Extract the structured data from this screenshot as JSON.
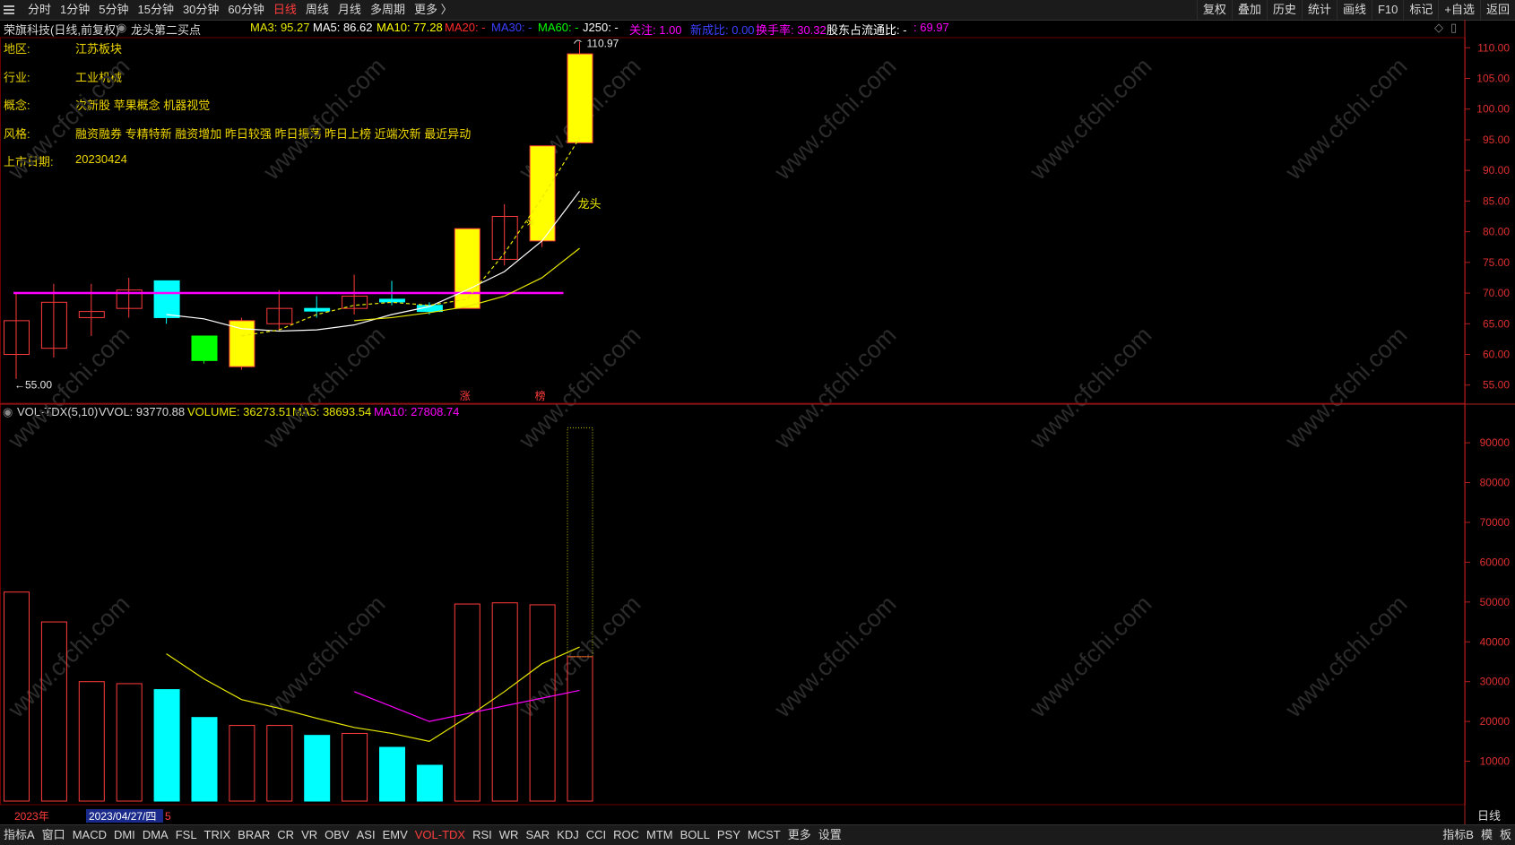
{
  "topbar": {
    "tabs": [
      "分时",
      "1分钟",
      "5分钟",
      "15分钟",
      "30分钟",
      "60分钟",
      "日线",
      "周线",
      "月线",
      "多周期",
      "更多 〉"
    ],
    "active_tab": "日线",
    "tools": [
      "复权",
      "叠加",
      "历史",
      "统计",
      "画线",
      "F10",
      "标记",
      "+自选",
      "返回"
    ]
  },
  "title": {
    "stock": "荣旗科技(日线,前复权)",
    "strategy": "龙头第二买点",
    "ma3": "MA3: 95.27",
    "ma5": "MA5: 86.62",
    "ma10": "MA10: 77.28",
    "ma20": "MA20: -",
    "ma30": "MA30: -",
    "ma60": "MA60: -",
    "j250": "J250: -",
    "focus": "关注: 1.00",
    "newrate": "新成比: 0.00",
    "turnover": "换手率: 30.32",
    "holders": "股东占流通比: -",
    "holders2": ": 69.97"
  },
  "info": [
    {
      "label": "地区:",
      "value": "江苏板块"
    },
    {
      "label": "行业:",
      "value": "工业机械"
    },
    {
      "label": "概念:",
      "value": "次新股 苹果概念 机器视觉"
    },
    {
      "label": "风格:",
      "value": "融资融券 专精特新 融资增加 昨日较强 昨日振荡 昨日上榜 近端次新 最近异动"
    },
    {
      "label": "上市日期:",
      "value": "20230424"
    }
  ],
  "annotations": {
    "high": "110.97",
    "low": "55.00",
    "leader": "龙头",
    "zhang": "涨",
    "bang": "榜",
    "year": "2023年",
    "date_cursor": "2023/04/27/四",
    "date_suffix": "5",
    "period_label": "日线"
  },
  "volume_header": {
    "name": "VOL-TDX(5,10)",
    "vvol": "VVOL: 93770.88",
    "volume": "VOLUME: 36273.51",
    "ma5": "MA5: 38693.54",
    "ma10": "MA10: 27808.74"
  },
  "bottombar": {
    "items": [
      "指标A",
      "窗口",
      "MACD",
      "DMI",
      "DMA",
      "FSL",
      "TRIX",
      "BRAR",
      "CR",
      "VR",
      "OBV",
      "ASI",
      "EMV",
      "VOL-TDX",
      "RSI",
      "WR",
      "SAR",
      "KDJ",
      "CCI",
      "ROC",
      "MTM",
      "BOLL",
      "PSY",
      "MCST",
      "更多",
      "设置"
    ],
    "active": "VOL-TDX",
    "right_items": [
      "指标B",
      "模",
      "板"
    ]
  },
  "watermark": "www.cfchi.com",
  "colors": {
    "up": "#ff3c3c",
    "up_strong": "#ffff00",
    "down": "#00ffff",
    "down_green": "#00ff00",
    "ma_white": "#ffffff",
    "ma_yellow": "#e8e800",
    "ma_magenta": "#ff00ff",
    "grid": "#6a0000"
  },
  "chart_data": {
    "type": "candlestick",
    "price_axis": {
      "ticks": [
        55,
        60,
        65,
        70,
        75,
        80,
        85,
        90,
        95,
        100,
        105,
        110
      ],
      "ylim": [
        53.5,
        111.5
      ]
    },
    "resistance_line": 70.0,
    "candles": [
      {
        "o": 60.0,
        "h": 70.0,
        "l": 56.0,
        "c": 65.5,
        "kind": "up"
      },
      {
        "o": 61.0,
        "h": 71.5,
        "l": 59.5,
        "c": 68.5,
        "kind": "up"
      },
      {
        "o": 66.0,
        "h": 71.5,
        "l": 63.0,
        "c": 67.0,
        "kind": "up"
      },
      {
        "o": 67.5,
        "h": 72.5,
        "l": 66.0,
        "c": 70.5,
        "kind": "up"
      },
      {
        "o": 72.0,
        "h": 72.0,
        "l": 65.0,
        "c": 66.0,
        "kind": "down"
      },
      {
        "o": 63.0,
        "h": 63.0,
        "l": 58.5,
        "c": 59.0,
        "kind": "green"
      },
      {
        "o": 58.0,
        "h": 66.0,
        "l": 57.5,
        "c": 65.5,
        "kind": "yellow"
      },
      {
        "o": 65.0,
        "h": 70.5,
        "l": 64.0,
        "c": 67.5,
        "kind": "up"
      },
      {
        "o": 67.5,
        "h": 69.5,
        "l": 66.0,
        "c": 67.5,
        "kind": "cross"
      },
      {
        "o": 67.5,
        "h": 73.0,
        "l": 66.5,
        "c": 69.5,
        "kind": "up"
      },
      {
        "o": 69.0,
        "h": 72.0,
        "l": 68.0,
        "c": 69.0,
        "kind": "cross"
      },
      {
        "o": 68.0,
        "h": 68.5,
        "l": 66.5,
        "c": 67.0,
        "kind": "down"
      },
      {
        "o": 67.5,
        "h": 80.5,
        "l": 67.5,
        "c": 80.5,
        "kind": "yellow"
      },
      {
        "o": 75.5,
        "h": 84.5,
        "l": 74.5,
        "c": 82.5,
        "kind": "up"
      },
      {
        "o": 78.5,
        "h": 94.0,
        "l": 77.5,
        "c": 94.0,
        "kind": "yellow"
      },
      {
        "o": 94.5,
        "h": 110.97,
        "l": 94.5,
        "c": 109.0,
        "kind": "yellow"
      }
    ],
    "ma5": [
      null,
      null,
      null,
      null,
      66.5,
      65.8,
      64.2,
      63.8,
      64.0,
      64.8,
      66.5,
      67.8,
      70.5,
      73.5,
      78.5,
      86.6
    ],
    "ma3": [
      null,
      null,
      null,
      null,
      null,
      null,
      63.0,
      64.0,
      66.5,
      68.0,
      68.5,
      68.0,
      69.0,
      76.5,
      85.5,
      95.3
    ],
    "ma10": [
      null,
      null,
      null,
      null,
      null,
      null,
      null,
      null,
      null,
      65.5,
      66.0,
      66.8,
      67.8,
      69.5,
      72.5,
      77.3
    ],
    "volume_axis": {
      "ticks": [
        10000,
        20000,
        30000,
        40000,
        50000,
        60000,
        70000,
        80000,
        90000
      ],
      "ylim": [
        0,
        97000
      ]
    },
    "volume": [
      52500,
      45000,
      30000,
      29500,
      28000,
      21000,
      19000,
      19000,
      16500,
      17000,
      13500,
      9000,
      49500,
      49800,
      49300,
      36273.51
    ],
    "vvol_last": 93770.88,
    "vol_ma5": [
      null,
      null,
      null,
      null,
      37000,
      30700,
      25500,
      23300,
      20800,
      18500,
      17000,
      15000,
      21000,
      27500,
      34500,
      38693.54
    ],
    "vol_ma10": [
      null,
      null,
      null,
      null,
      null,
      null,
      null,
      null,
      null,
      27500,
      null,
      20000,
      null,
      null,
      null,
      27808.74
    ]
  }
}
